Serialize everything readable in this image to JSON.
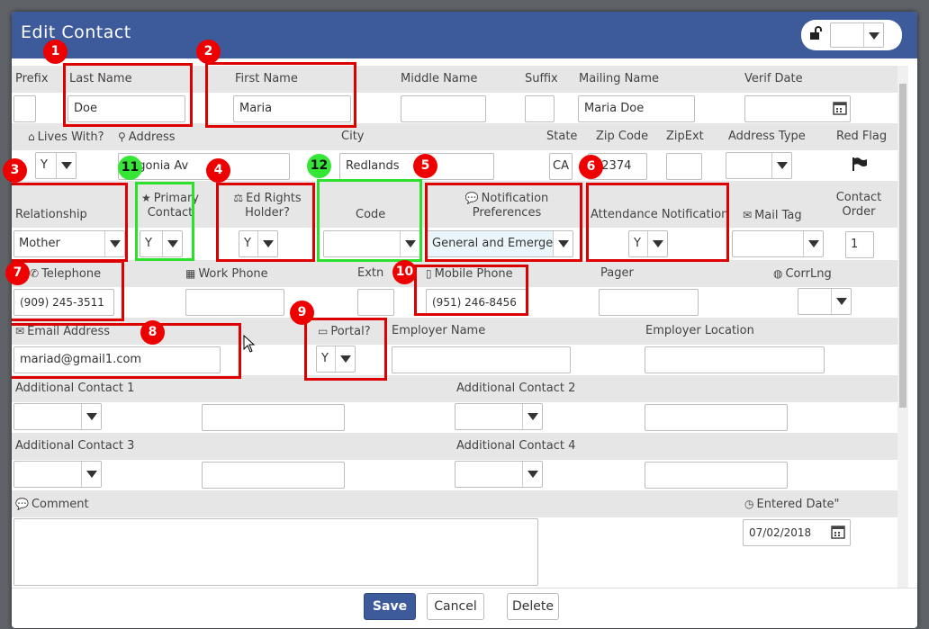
{
  "dialog": {
    "title": "Edit Contact"
  },
  "header_lock": {
    "value": ""
  },
  "row1": {
    "labels": {
      "prefix": "Prefix",
      "last_name": "Last Name",
      "first_name": "First Name",
      "middle_name": "Middle Name",
      "suffix": "Suffix",
      "mailing_name": "Mailing Name",
      "verif_date": "Verif Date"
    },
    "values": {
      "prefix": "",
      "last_name": "Doe",
      "first_name": "Maria",
      "middle_name": "",
      "suffix": "",
      "mailing_name": "Maria Doe",
      "verif_date": ""
    }
  },
  "row2": {
    "labels": {
      "lives_with": "Lives With?",
      "address": "Address",
      "city": "City",
      "state": "State",
      "zip": "Zip Code",
      "zipext": "ZipExt",
      "address_type": "Address Type",
      "red_flag": "Red Flag"
    },
    "values": {
      "lives_with": "Y",
      "address": "Lugonia Av",
      "city": "Redlands",
      "state": "CA",
      "zip": "92374",
      "zipext": "",
      "address_type": ""
    }
  },
  "row3": {
    "labels": {
      "relationship": "Relationship",
      "primary_contact": "Primary Contact",
      "ed_rights": "Ed Rights Holder?",
      "code": "Code",
      "notification_prefs": "Notification Preferences",
      "attendance_notification": "Attendance Notification",
      "mail_tag": "Mail Tag",
      "contact_order": "Contact Order"
    },
    "values": {
      "relationship": "Mother",
      "primary_contact": "Y",
      "ed_rights": "Y",
      "code": "",
      "notification_prefs": "General and Emergency",
      "attendance_notification": "Y",
      "mail_tag": "",
      "contact_order": "1"
    }
  },
  "row4": {
    "labels": {
      "telephone": "Telephone",
      "work_phone": "Work Phone",
      "extn": "Extn",
      "mobile_phone": "Mobile Phone",
      "pager": "Pager",
      "corrlng": "CorrLng"
    },
    "values": {
      "telephone": "(909) 245-3511",
      "work_phone": "",
      "extn": "",
      "mobile_phone": "(951) 246-8456",
      "pager": "",
      "corrlng": ""
    }
  },
  "row5": {
    "labels": {
      "email": "Email Address",
      "portal": "Portal?",
      "employer_name": "Employer Name",
      "employer_location": "Employer Location"
    },
    "values": {
      "email": "mariad@gmail1.com",
      "portal": "Y",
      "employer_name": "",
      "employer_location": ""
    }
  },
  "row6": {
    "labels": {
      "additional_contact_1": "Additional Contact 1",
      "additional_contact_2": "Additional Contact 2"
    }
  },
  "row7": {
    "labels": {
      "additional_contact_3": "Additional Contact 3",
      "additional_contact_4": "Additional Contact 4"
    }
  },
  "row8": {
    "labels": {
      "comment": "Comment",
      "entered_date": "Entered Date\""
    },
    "values": {
      "comment": "",
      "entered_date": "07/02/2018"
    }
  },
  "buttons": {
    "save": "Save",
    "cancel": "Cancel",
    "delete": "Delete"
  },
  "markers": [
    "1",
    "2",
    "3",
    "4",
    "5",
    "6",
    "7",
    "8",
    "9",
    "10",
    "11",
    "12"
  ],
  "colors": {
    "header": "#3d5a9a",
    "highlight_red": "#dd0000",
    "highlight_green": "#2ee02e"
  }
}
